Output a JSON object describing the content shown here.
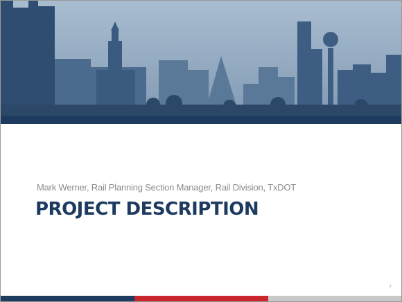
{
  "slide": {
    "subtitle": "Mark Werner, Rail Planning Section Manager, Rail Division, TxDOT",
    "title": "PROJECT DESCRIPTION",
    "page_number": "7"
  },
  "colors": {
    "brand_blue": "#1d3a5f",
    "brand_red": "#c9252c",
    "footer_grey": "#c8c8c8"
  }
}
